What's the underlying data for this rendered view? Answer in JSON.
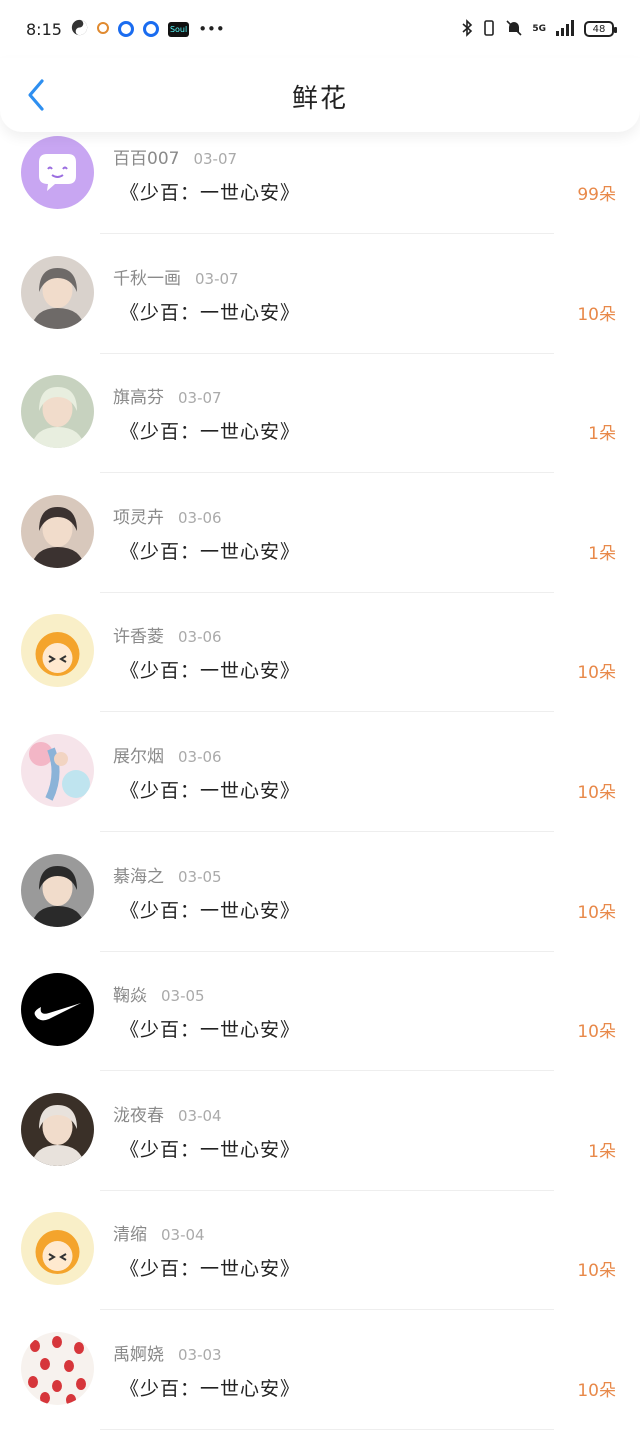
{
  "status_bar": {
    "time": "8:15",
    "battery": "48",
    "network": "5G"
  },
  "header": {
    "title": "鲜花"
  },
  "colors": {
    "accent_blue": "#2e8ff0",
    "amount_orange": "#e8894a"
  },
  "rows": [
    {
      "name": "百百007",
      "date": "03-07",
      "book": "《少百：一世心安》",
      "amount": "99朵",
      "avatar": "chat-bubble-avatar"
    },
    {
      "name": "千秋一画",
      "date": "03-07",
      "book": "《少百：一世心安》",
      "amount": "10朵",
      "avatar": "portrait-avatar"
    },
    {
      "name": "旗高芬",
      "date": "03-07",
      "book": "《少百：一世心安》",
      "amount": "1朵",
      "avatar": "portrait-avatar"
    },
    {
      "name": "项灵卉",
      "date": "03-06",
      "book": "《少百：一世心安》",
      "amount": "1朵",
      "avatar": "portrait-avatar"
    },
    {
      "name": "许香菱",
      "date": "03-06",
      "book": "《少百：一世心安》",
      "amount": "10朵",
      "avatar": "cartoon-avatar"
    },
    {
      "name": "展尔烟",
      "date": "03-06",
      "book": "《少百：一世心安》",
      "amount": "10朵",
      "avatar": "painting-avatar"
    },
    {
      "name": "綦海之",
      "date": "03-05",
      "book": "《少百：一世心安》",
      "amount": "10朵",
      "avatar": "portrait-avatar"
    },
    {
      "name": "鞠焱",
      "date": "03-05",
      "book": "《少百：一世心安》",
      "amount": "10朵",
      "avatar": "swoosh-logo-avatar"
    },
    {
      "name": "泷夜春",
      "date": "03-04",
      "book": "《少百：一世心安》",
      "amount": "1朵",
      "avatar": "portrait-avatar"
    },
    {
      "name": "清缩",
      "date": "03-04",
      "book": "《少百：一世心安》",
      "amount": "10朵",
      "avatar": "cartoon-avatar"
    },
    {
      "name": "禹婀娆",
      "date": "03-03",
      "book": "《少百：一世心安》",
      "amount": "10朵",
      "avatar": "strawberry-avatar"
    }
  ]
}
